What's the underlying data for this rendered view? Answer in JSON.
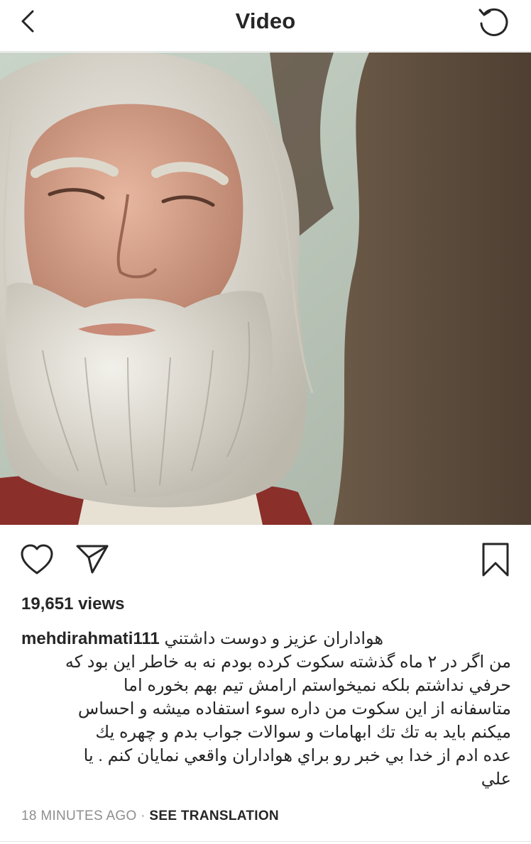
{
  "header": {
    "title": "Video",
    "back_icon": "chevron-left-icon",
    "refresh_icon": "refresh-icon"
  },
  "video": {
    "description_icon": "video-frame"
  },
  "actions": {
    "like_icon": "heart-icon",
    "share_icon": "paper-plane-icon",
    "save_icon": "bookmark-icon"
  },
  "post": {
    "views": "19,651 views",
    "username": "mehdirahmati111",
    "caption_first": "هواداران عزيز و دوست داشتني",
    "caption_body": "من اگر در ٢ ماه گذشته سكوت كرده بودم نه به خاطر اين بود كه\nحرفي نداشتم بلكه نميخواستم ارامش تيم بهم بخوره اما\nمتاسفانه از اين سكوت من داره سوء استفاده ميشه و احساس\nميكنم بايد به تك تك ابهامات و سوالات جواب بدم و چهره يك\nعده ادم از خدا بي خبر رو براي هواداران واقعي نمايان كنم . يا\nعلي",
    "time": "18 MINUTES AGO",
    "separator": "·",
    "see_translation": "SEE TRANSLATION"
  },
  "colors": {
    "text": "#262626",
    "muted": "#8e8e8e",
    "divider": "#dbdbdb"
  }
}
